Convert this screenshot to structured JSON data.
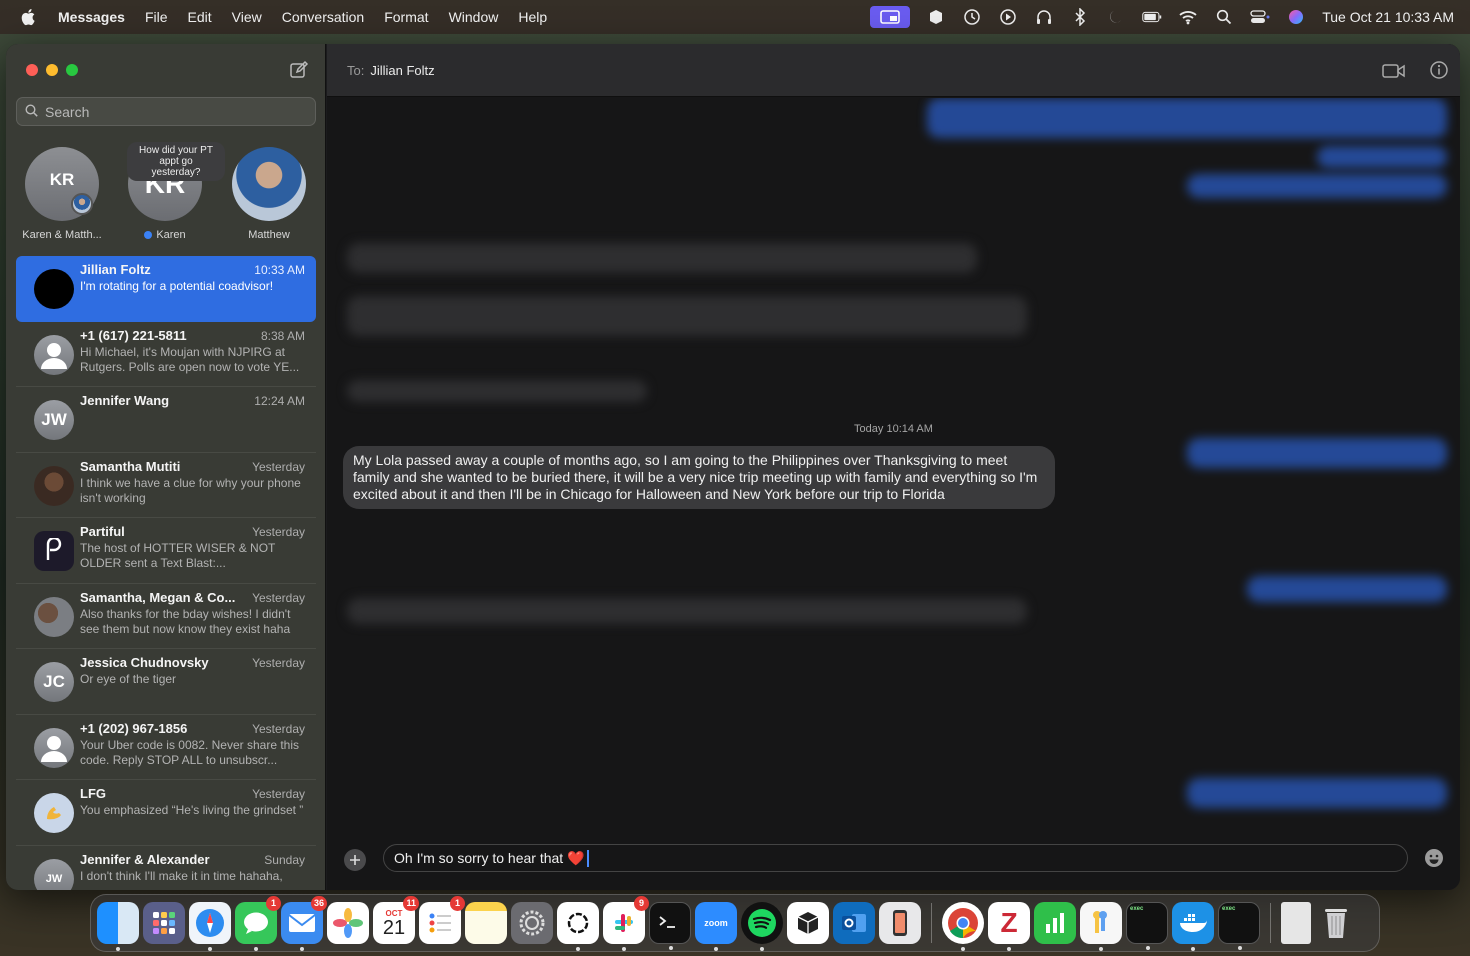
{
  "menubar": {
    "app_name": "Messages",
    "menus": [
      "File",
      "Edit",
      "View",
      "Conversation",
      "Format",
      "Window",
      "Help"
    ],
    "clock": "Tue Oct 21  10:33 AM"
  },
  "sidebar": {
    "search_placeholder": "Search",
    "pinned": [
      {
        "initials": "KR",
        "name": "Karen & Matth..."
      },
      {
        "initials": "KR",
        "name": "Karen",
        "bubble": "How did your PT appt go yesterday?",
        "unread": true
      },
      {
        "initials": "",
        "name": "Matthew"
      }
    ],
    "conversations": [
      {
        "name": "Jillian Foltz",
        "time": "10:33 AM",
        "preview": "I'm rotating for a potential coadvisor!",
        "initials": "",
        "selected": true
      },
      {
        "name": "+1 (617) 221-5811",
        "time": "8:38 AM",
        "preview": "Hi Michael, it's Moujan with NJPIRG at Rutgers. Polls are open now to vote YE...",
        "initials": ""
      },
      {
        "name": "Jennifer Wang",
        "time": "12:24 AM",
        "preview": "",
        "initials": "JW"
      },
      {
        "name": "Samantha Mutiti",
        "time": "Yesterday",
        "preview": "I think we have a clue for why your phone isn't working",
        "initials": ""
      },
      {
        "name": "Partiful",
        "time": "Yesterday",
        "preview": "The host of HOTTER WISER & NOT OLDER sent a Text Blast:...",
        "initials": ""
      },
      {
        "name": "Samantha, Megan & Co...",
        "time": "Yesterday",
        "preview": "Also thanks for the bday wishes! I didn't see them but now know they exist haha",
        "initials": ""
      },
      {
        "name": "Jessica Chudnovsky",
        "time": "Yesterday",
        "preview": "Or eye of the tiger",
        "initials": "JC"
      },
      {
        "name": "+1 (202) 967-1856",
        "time": "Yesterday",
        "preview": "Your Uber code is 0082. Never share this code. Reply STOP ALL to unsubscr...",
        "initials": ""
      },
      {
        "name": "LFG",
        "time": "Yesterday",
        "preview": "You emphasized “He's living the grindset ”",
        "initials": ""
      },
      {
        "name": "Jennifer & Alexander",
        "time": "Sunday",
        "preview": "I don't think I'll make it in time hahaha,",
        "initials": "JW"
      }
    ]
  },
  "conversation": {
    "to_label": "To:",
    "to_name": "Jillian Foltz",
    "timestamp": "Today 10:14 AM",
    "message": "My Lola passed away a couple of months ago, so I am going to the Philippines over Thanksgiving to meet family and she wanted to be buried there, it will be a very nice trip meeting up with family and everything so I'm excited about it and then I'll be in Chicago for Halloween and New York before our trip to Florida",
    "draft": "Oh I'm so sorry to hear that ❤️"
  },
  "dock": {
    "badges": {
      "messages": "1",
      "mail": "36",
      "calendar": "11",
      "reminders": "1",
      "slack": "9"
    },
    "calendar_month": "OCT",
    "calendar_day": "21",
    "zoom_label": "zoom",
    "exec_label": "exec"
  }
}
